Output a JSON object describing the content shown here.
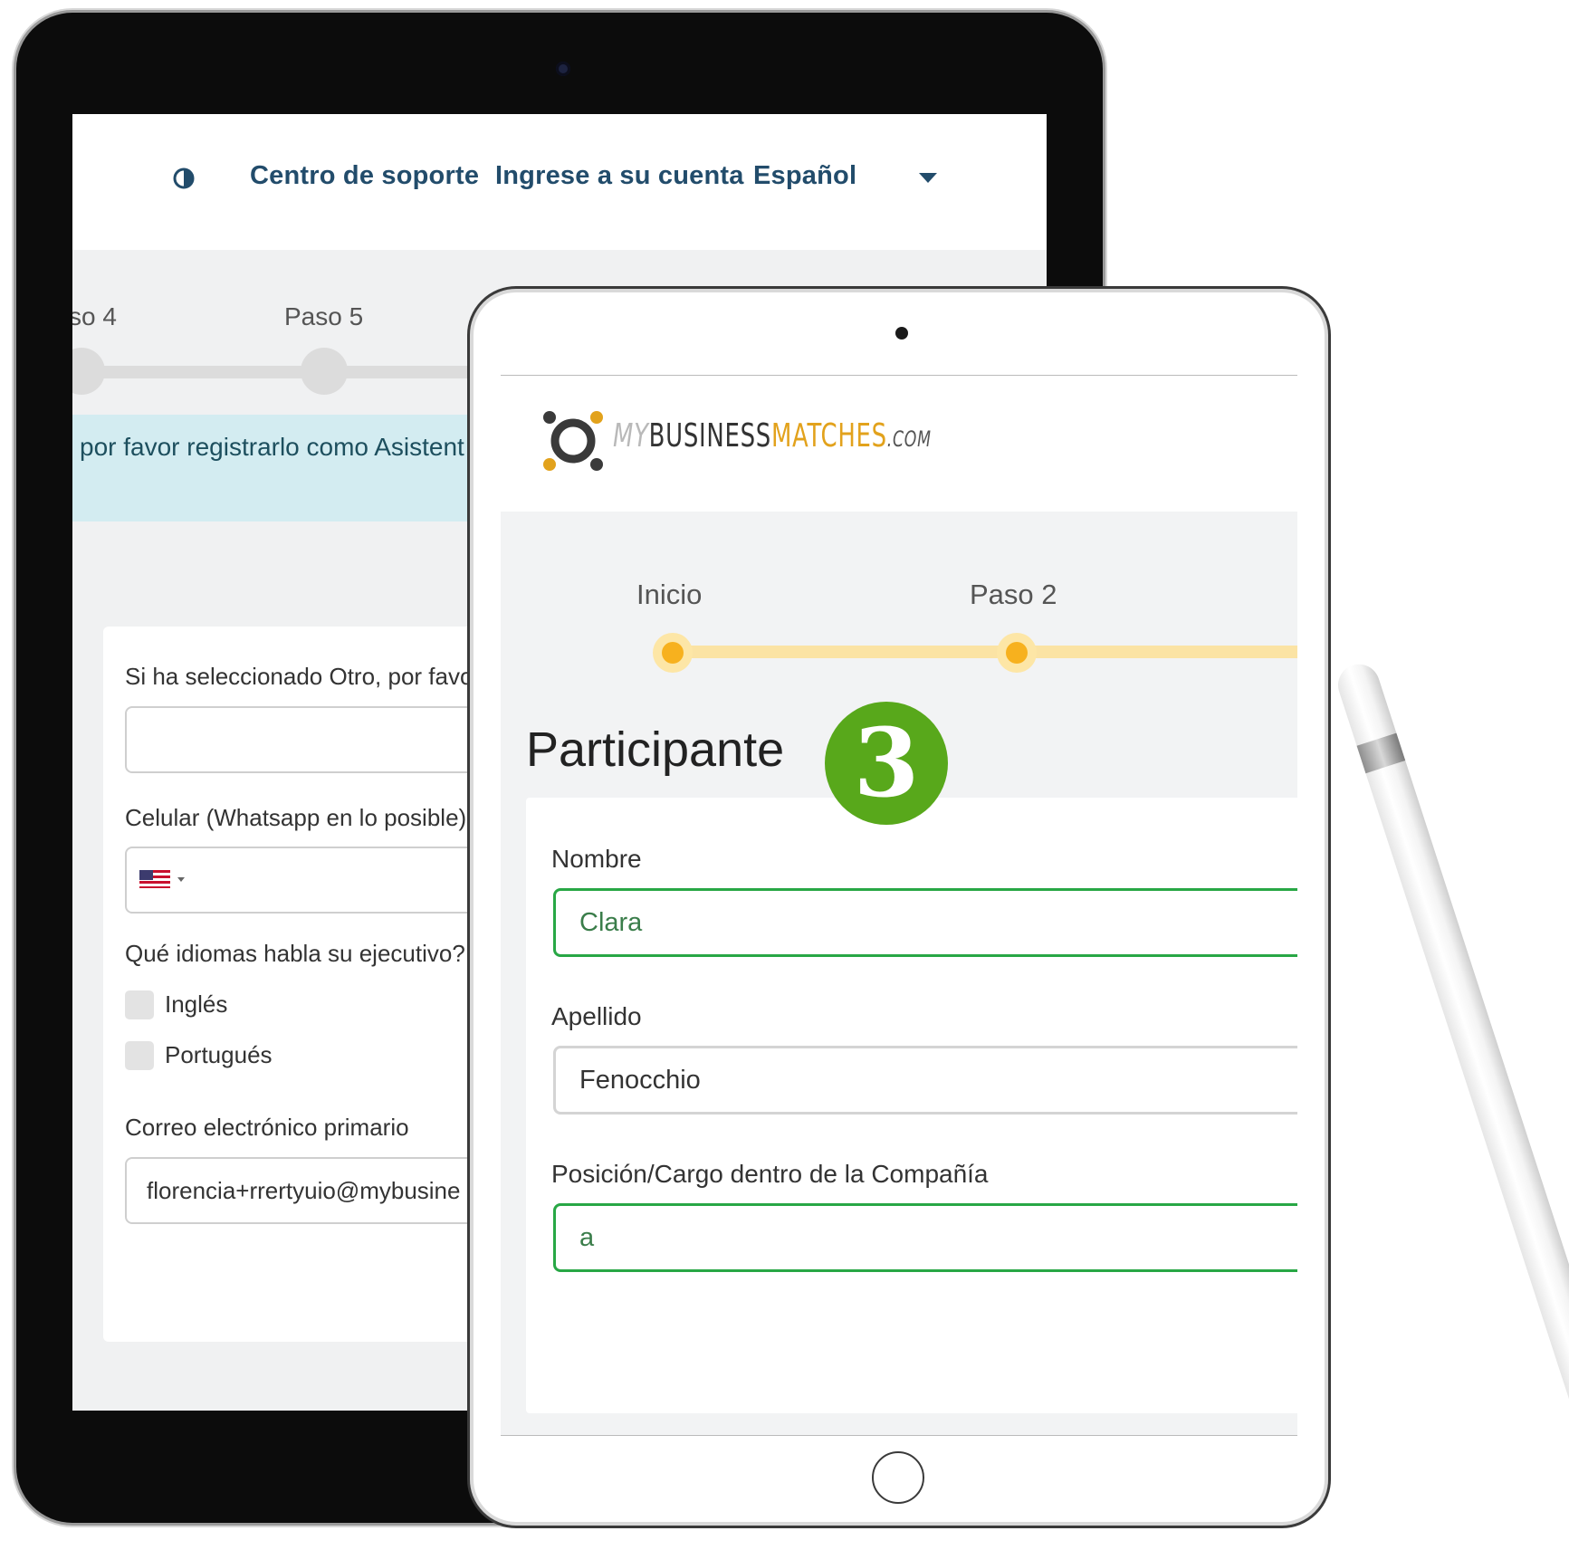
{
  "back_tablet": {
    "nav": {
      "support": "Centro de soporte",
      "login": "Ingrese a su cuenta",
      "language": "Español"
    },
    "steps": [
      "so 4",
      "Paso 5"
    ],
    "alert": "por favor registrarlo como Asistent",
    "form": {
      "other_label": "Si ha seleccionado Otro, por favo",
      "phone_label": "Celular (Whatsapp en lo posible)",
      "languages_label": "Qué idiomas habla su ejecutivo?",
      "opt_english": "Inglés",
      "opt_portuguese": "Portugués",
      "email_label": "Correo electrónico primario",
      "email_value": "florencia+rrertyuio@mybusine"
    }
  },
  "front_tablet": {
    "logo": {
      "my": "MY",
      "business": "BUSINESS",
      "matches": "MATCHES",
      "com": ".COM"
    },
    "steps": [
      "Inicio",
      "Paso 2"
    ],
    "title": "Participante",
    "badge": "3",
    "form": {
      "first_name_label": "Nombre",
      "first_name_value": "Clara",
      "last_name_label": "Apellido",
      "last_name_value": "Fenocchio",
      "position_label": "Posición/Cargo dentro de la Compañía",
      "position_value": "a"
    }
  },
  "colors": {
    "nav_link": "#224c6b",
    "valid_border": "#28a745",
    "step_accent": "#f7b11e",
    "badge": "#58a81b",
    "brand_gold": "#e2a21c"
  }
}
